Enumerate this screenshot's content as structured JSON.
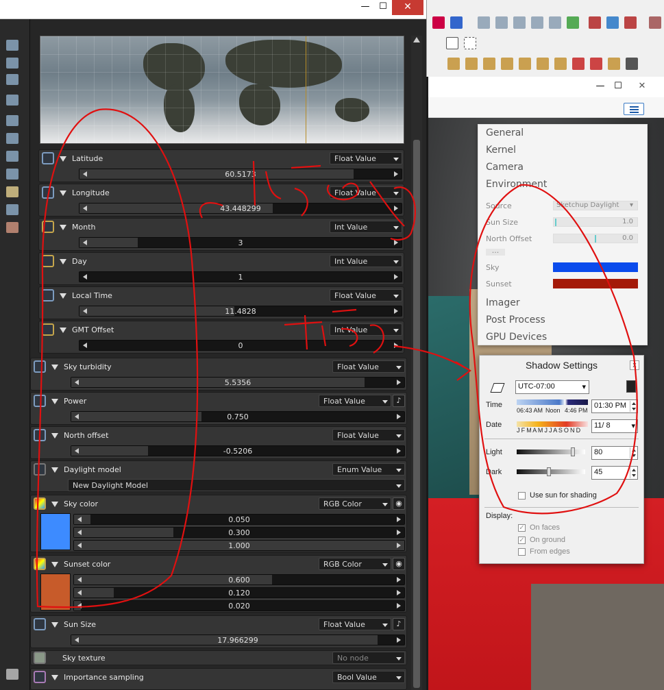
{
  "left_window": {
    "controls": {
      "minimize": "—",
      "maximize": "☐",
      "close": "✕"
    },
    "params": [
      {
        "label": "Latitude",
        "type": "Float Value",
        "value": "60.5173",
        "pin": "curve"
      },
      {
        "label": "Longitude",
        "type": "Float Value",
        "value": "43.448299",
        "pin": "curve"
      },
      {
        "label": "Month",
        "type": "Int Value",
        "value": "3",
        "pin": "int"
      },
      {
        "label": "Day",
        "type": "Int Value",
        "value": "1",
        "pin": "int"
      },
      {
        "label": "Local Time",
        "type": "Float Value",
        "value": "11.4828",
        "pin": "curve"
      },
      {
        "label": "GMT Offset",
        "type": "Int Value",
        "value": "0",
        "pin": "int"
      },
      {
        "label": "Sky turbidity",
        "type": "Float Value",
        "value": "5.5356",
        "pin": "curve"
      },
      {
        "label": "Power",
        "type": "Float Value",
        "value": "0.750",
        "pin": "curve"
      },
      {
        "label": "North offset",
        "type": "Float Value",
        "value": "-0.5206",
        "pin": "curve"
      },
      {
        "label": "Daylight model",
        "type": "Enum Value",
        "value": "New Daylight Model",
        "pin": "enum"
      },
      {
        "label": "Sky color",
        "type": "RGB Color",
        "values": [
          "0.050",
          "0.300",
          "1.000"
        ],
        "pin": "color"
      },
      {
        "label": "Sunset color",
        "type": "RGB Color",
        "values": [
          "0.600",
          "0.120",
          "0.020"
        ],
        "pin": "color"
      },
      {
        "label": "Sun Size",
        "type": "Float Value",
        "value": "17.966299",
        "pin": "curve"
      },
      {
        "label": "Sky texture",
        "type": "No node"
      },
      {
        "label": "Importance sampling",
        "type": "Bool Value",
        "pin": "bool"
      }
    ],
    "fills": {
      "latitude": 0.85,
      "longitude": 0.6,
      "month": 0.18,
      "day": 0.0,
      "local_time": 0.48,
      "gmt": 0.0,
      "turbidity": 0.88,
      "power": 0.39,
      "north": 0.23,
      "sky_r": 0.05,
      "sky_g": 0.3,
      "sky_b": 1.0,
      "sun_r": 0.6,
      "sun_g": 0.12,
      "sun_b": 0.02,
      "sun_size": 0.92
    },
    "swatches": {
      "sky": "#3d8bff",
      "sunset": "#c75b2a"
    }
  },
  "right_window": {
    "controls": {
      "minimize": "—",
      "maximize": "☐",
      "close": "✕"
    },
    "env_panel": {
      "sections": [
        "General",
        "Kernel",
        "Camera",
        "Environment",
        "Imager",
        "Post Process",
        "GPU Devices"
      ],
      "source_label": "Source",
      "source_value": "Sketchup Daylight",
      "sun_size_label": "Sun Size",
      "sun_size_value": "1.0",
      "north_offset_label": "North Offset",
      "north_offset_value": "0.0",
      "more": "...",
      "sky_label": "Sky",
      "sky_color": "#0a4bec",
      "sunset_label": "Sunset",
      "sunset_color": "#a41a09"
    },
    "shadow": {
      "title": "Shadow Settings",
      "close": "x",
      "timezone": "UTC-07:00",
      "time_label": "Time",
      "time_start": "06:43 AM",
      "time_noon": "Noon",
      "time_end": "4:46 PM",
      "time_value": "01:30 PM",
      "date_label": "Date",
      "months": "J F M A M J J A S O N D",
      "date_value": "11/ 8",
      "light_label": "Light",
      "light_value": "80",
      "dark_label": "Dark",
      "dark_value": "45",
      "use_sun": "Use sun for shading",
      "display_label": "Display:",
      "on_faces": "On faces",
      "on_ground": "On ground",
      "from_edges": "From edges"
    }
  }
}
